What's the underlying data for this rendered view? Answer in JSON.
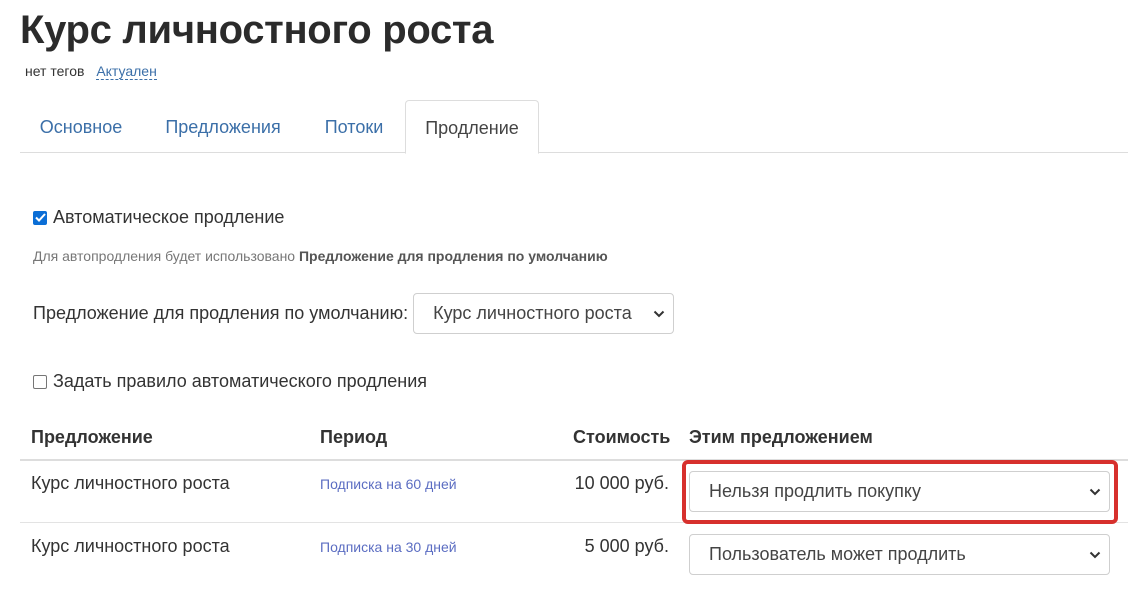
{
  "page": {
    "title": "Курс личностного роста",
    "tags_text": "нет тегов",
    "status_link": "Актуален"
  },
  "tabs": [
    {
      "label": "Основное",
      "active": false
    },
    {
      "label": "Предложения",
      "active": false
    },
    {
      "label": "Потоки",
      "active": false
    },
    {
      "label": "Продление",
      "active": true
    }
  ],
  "renewal": {
    "auto_renewal_label": "Автоматическое продление",
    "auto_renewal_checked": true,
    "hint_prefix": "Для автопродления будет использовано ",
    "hint_bold": "Предложение для продления по умолчанию",
    "default_offer_label": "Предложение для продления по умолчанию:",
    "default_offer_value": "Курс личностного роста",
    "rule_label": "Задать правило автоматического продления",
    "rule_checked": false
  },
  "table": {
    "headers": {
      "offer": "Предложение",
      "period": "Период",
      "cost": "Стоимость",
      "action": "Этим предложением"
    },
    "rows": [
      {
        "offer": "Курс личностного роста",
        "period": "Подписка на 60 дней",
        "cost": "10 000 руб.",
        "action": "Нельзя продлить покупку",
        "highlighted": true
      },
      {
        "offer": "Курс личностного роста",
        "period": "Подписка на 30 дней",
        "cost": "5 000 руб.",
        "action": "Пользователь может продлить",
        "highlighted": false
      }
    ]
  },
  "colors": {
    "link": "#3b6fa8",
    "period_link": "#5b6dc2",
    "highlight": "#d7302d",
    "checkbox": "#0b6ed6"
  }
}
